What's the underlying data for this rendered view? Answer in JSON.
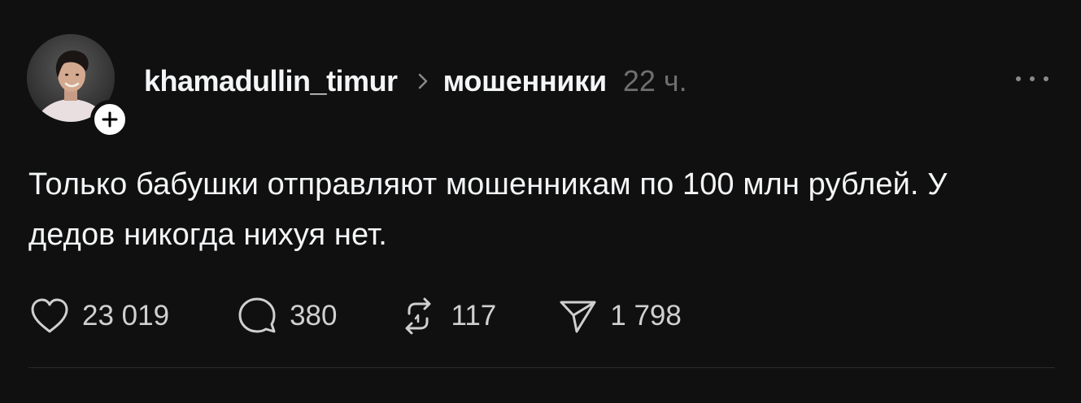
{
  "post": {
    "username": "khamadullin_timur",
    "topic": "мошенники",
    "time": "22 ч.",
    "text": "Только бабушки отправляют мошенникам по 100 млн рублей. У дедов никогда нихуя нет.",
    "actions": {
      "likes": "23 019",
      "comments": "380",
      "reposts": "117",
      "shares": "1 798"
    }
  },
  "icons": {
    "avatar": "user-avatar",
    "follow": "plus-icon",
    "separator": "chevron-right-icon",
    "more": "more-horizontal-icon",
    "like": "heart-icon",
    "comment": "comment-icon",
    "repost": "repost-icon",
    "share": "send-icon"
  },
  "colors": {
    "background": "#101010",
    "primary_text": "#f3f5f7",
    "secondary_text": "#6f6f6f",
    "divider": "#2b2b2b"
  }
}
